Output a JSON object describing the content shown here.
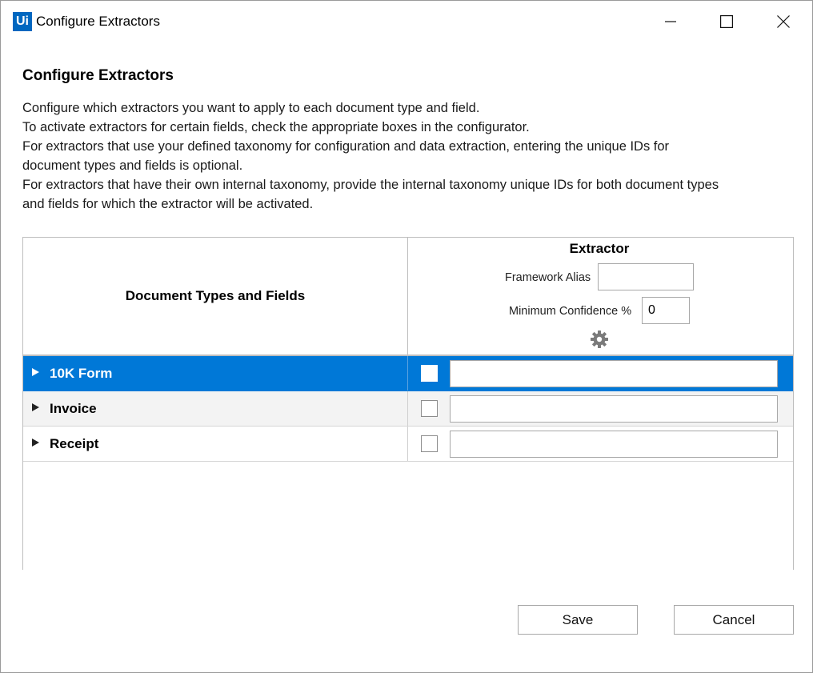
{
  "window": {
    "logo_text": "Ui",
    "title": "Configure Extractors"
  },
  "header": {
    "heading": "Configure Extractors",
    "description": [
      "Configure which extractors you want to apply to each document type and field.",
      "To activate extractors for certain fields, check the appropriate boxes in the configurator.",
      "For extractors that use your defined taxonomy for configuration and data extraction, entering the unique IDs for",
      "document types and fields is optional.",
      "For extractors that have their own internal taxonomy, provide the internal taxonomy unique IDs for both document types",
      "and fields for which the extractor will be activated."
    ]
  },
  "grid": {
    "left_header": "Document Types and Fields",
    "extractor": {
      "title": "Extractor",
      "framework_alias_label": "Framework Alias",
      "framework_alias_value": "",
      "min_confidence_label": "Minimum Confidence %",
      "min_confidence_value": "0",
      "settings_icon": "gear-icon"
    },
    "rows": [
      {
        "label": "10K Form",
        "checked": false,
        "id_value": "",
        "selected": true
      },
      {
        "label": "Invoice",
        "checked": false,
        "id_value": "",
        "selected": false
      },
      {
        "label": "Receipt",
        "checked": false,
        "id_value": "",
        "selected": false
      }
    ]
  },
  "footer": {
    "save_label": "Save",
    "cancel_label": "Cancel"
  },
  "colors": {
    "selection": "#0078d7",
    "logo": "#0067c0"
  }
}
